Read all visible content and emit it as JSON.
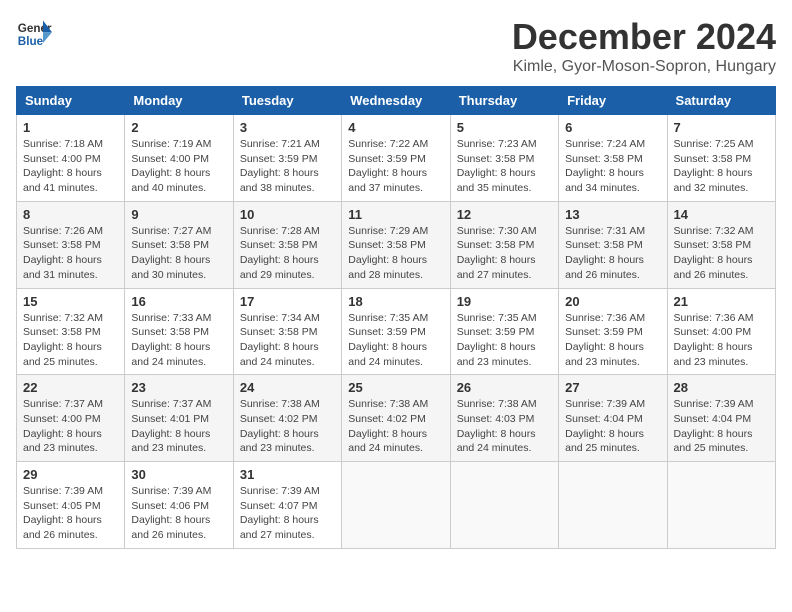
{
  "logo": {
    "line1": "General",
    "line2": "Blue"
  },
  "title": "December 2024",
  "location": "Kimle, Gyor-Moson-Sopron, Hungary",
  "days_of_week": [
    "Sunday",
    "Monday",
    "Tuesday",
    "Wednesday",
    "Thursday",
    "Friday",
    "Saturday"
  ],
  "weeks": [
    [
      {
        "day": "1",
        "info": "Sunrise: 7:18 AM\nSunset: 4:00 PM\nDaylight: 8 hours\nand 41 minutes."
      },
      {
        "day": "2",
        "info": "Sunrise: 7:19 AM\nSunset: 4:00 PM\nDaylight: 8 hours\nand 40 minutes."
      },
      {
        "day": "3",
        "info": "Sunrise: 7:21 AM\nSunset: 3:59 PM\nDaylight: 8 hours\nand 38 minutes."
      },
      {
        "day": "4",
        "info": "Sunrise: 7:22 AM\nSunset: 3:59 PM\nDaylight: 8 hours\nand 37 minutes."
      },
      {
        "day": "5",
        "info": "Sunrise: 7:23 AM\nSunset: 3:58 PM\nDaylight: 8 hours\nand 35 minutes."
      },
      {
        "day": "6",
        "info": "Sunrise: 7:24 AM\nSunset: 3:58 PM\nDaylight: 8 hours\nand 34 minutes."
      },
      {
        "day": "7",
        "info": "Sunrise: 7:25 AM\nSunset: 3:58 PM\nDaylight: 8 hours\nand 32 minutes."
      }
    ],
    [
      {
        "day": "8",
        "info": "Sunrise: 7:26 AM\nSunset: 3:58 PM\nDaylight: 8 hours\nand 31 minutes."
      },
      {
        "day": "9",
        "info": "Sunrise: 7:27 AM\nSunset: 3:58 PM\nDaylight: 8 hours\nand 30 minutes."
      },
      {
        "day": "10",
        "info": "Sunrise: 7:28 AM\nSunset: 3:58 PM\nDaylight: 8 hours\nand 29 minutes."
      },
      {
        "day": "11",
        "info": "Sunrise: 7:29 AM\nSunset: 3:58 PM\nDaylight: 8 hours\nand 28 minutes."
      },
      {
        "day": "12",
        "info": "Sunrise: 7:30 AM\nSunset: 3:58 PM\nDaylight: 8 hours\nand 27 minutes."
      },
      {
        "day": "13",
        "info": "Sunrise: 7:31 AM\nSunset: 3:58 PM\nDaylight: 8 hours\nand 26 minutes."
      },
      {
        "day": "14",
        "info": "Sunrise: 7:32 AM\nSunset: 3:58 PM\nDaylight: 8 hours\nand 26 minutes."
      }
    ],
    [
      {
        "day": "15",
        "info": "Sunrise: 7:32 AM\nSunset: 3:58 PM\nDaylight: 8 hours\nand 25 minutes."
      },
      {
        "day": "16",
        "info": "Sunrise: 7:33 AM\nSunset: 3:58 PM\nDaylight: 8 hours\nand 24 minutes."
      },
      {
        "day": "17",
        "info": "Sunrise: 7:34 AM\nSunset: 3:58 PM\nDaylight: 8 hours\nand 24 minutes."
      },
      {
        "day": "18",
        "info": "Sunrise: 7:35 AM\nSunset: 3:59 PM\nDaylight: 8 hours\nand 24 minutes."
      },
      {
        "day": "19",
        "info": "Sunrise: 7:35 AM\nSunset: 3:59 PM\nDaylight: 8 hours\nand 23 minutes."
      },
      {
        "day": "20",
        "info": "Sunrise: 7:36 AM\nSunset: 3:59 PM\nDaylight: 8 hours\nand 23 minutes."
      },
      {
        "day": "21",
        "info": "Sunrise: 7:36 AM\nSunset: 4:00 PM\nDaylight: 8 hours\nand 23 minutes."
      }
    ],
    [
      {
        "day": "22",
        "info": "Sunrise: 7:37 AM\nSunset: 4:00 PM\nDaylight: 8 hours\nand 23 minutes."
      },
      {
        "day": "23",
        "info": "Sunrise: 7:37 AM\nSunset: 4:01 PM\nDaylight: 8 hours\nand 23 minutes."
      },
      {
        "day": "24",
        "info": "Sunrise: 7:38 AM\nSunset: 4:02 PM\nDaylight: 8 hours\nand 23 minutes."
      },
      {
        "day": "25",
        "info": "Sunrise: 7:38 AM\nSunset: 4:02 PM\nDaylight: 8 hours\nand 24 minutes."
      },
      {
        "day": "26",
        "info": "Sunrise: 7:38 AM\nSunset: 4:03 PM\nDaylight: 8 hours\nand 24 minutes."
      },
      {
        "day": "27",
        "info": "Sunrise: 7:39 AM\nSunset: 4:04 PM\nDaylight: 8 hours\nand 25 minutes."
      },
      {
        "day": "28",
        "info": "Sunrise: 7:39 AM\nSunset: 4:04 PM\nDaylight: 8 hours\nand 25 minutes."
      }
    ],
    [
      {
        "day": "29",
        "info": "Sunrise: 7:39 AM\nSunset: 4:05 PM\nDaylight: 8 hours\nand 26 minutes."
      },
      {
        "day": "30",
        "info": "Sunrise: 7:39 AM\nSunset: 4:06 PM\nDaylight: 8 hours\nand 26 minutes."
      },
      {
        "day": "31",
        "info": "Sunrise: 7:39 AM\nSunset: 4:07 PM\nDaylight: 8 hours\nand 27 minutes."
      },
      {
        "day": "",
        "info": ""
      },
      {
        "day": "",
        "info": ""
      },
      {
        "day": "",
        "info": ""
      },
      {
        "day": "",
        "info": ""
      }
    ]
  ]
}
